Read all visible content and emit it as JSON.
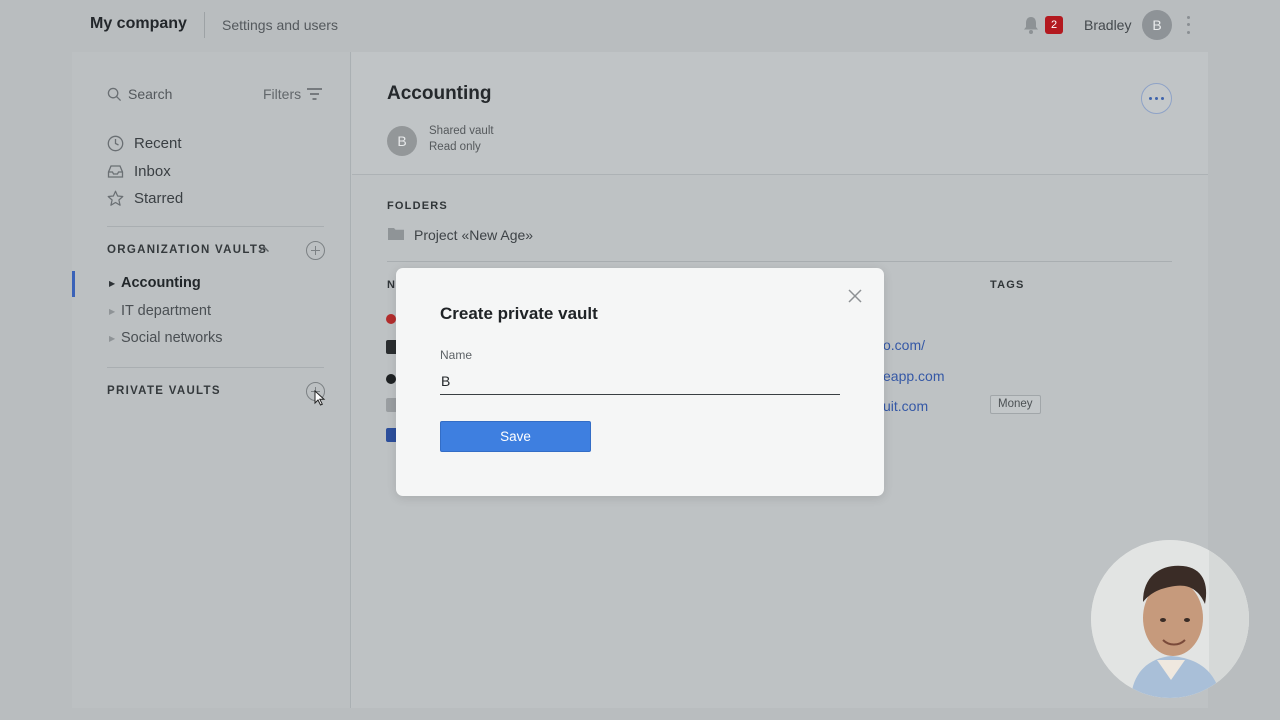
{
  "topbar": {
    "company": "My company",
    "settings_link": "Settings and users",
    "notification_count": "2",
    "username": "Bradley",
    "avatar_initial": "B"
  },
  "sidebar": {
    "search_placeholder": "Search",
    "filters_label": "Filters",
    "nav": [
      {
        "label": "Recent",
        "icon": "clock-icon"
      },
      {
        "label": "Inbox",
        "icon": "inbox-icon"
      },
      {
        "label": "Starred",
        "icon": "star-icon"
      }
    ],
    "org_vaults_title": "ORGANIZATION VAULTS",
    "org_vaults": [
      {
        "label": "Accounting",
        "active": true
      },
      {
        "label": "IT department",
        "active": false
      },
      {
        "label": "Social networks",
        "active": false
      }
    ],
    "private_vaults_title": "PRIVATE VAULTS"
  },
  "main": {
    "vault_title": "Accounting",
    "vault_avatar": "B",
    "vault_type": "Shared vault",
    "vault_access": "Read only",
    "folders_heading": "FOLDERS",
    "folder_name": "Project «New Age»",
    "col_name": "N",
    "col_tags": "TAGS",
    "url_1": "o.com/",
    "url_2": "eapp.com",
    "url_3": "uit.com",
    "tag_1": "Money"
  },
  "dialog": {
    "title": "Create private vault",
    "name_label": "Name",
    "name_value": "B",
    "save_label": "Save"
  },
  "colors": {
    "accent": "#3e7fe0",
    "badge": "#b3191f",
    "active_bar": "#3a62b8"
  }
}
